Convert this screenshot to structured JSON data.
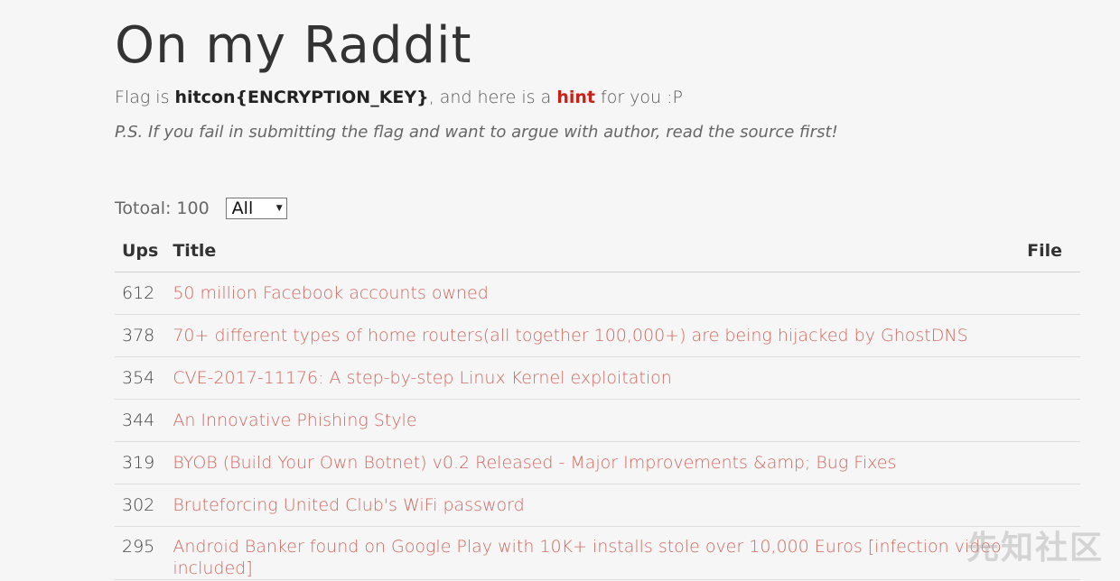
{
  "header": {
    "title": "On my Raddit",
    "flag_prefix": "Flag is ",
    "flag_value": "hitcon{ENCRYPTION_KEY}",
    "flag_middle": ", and here is a ",
    "hint_label": "hint",
    "flag_suffix": " for you :P",
    "ps_note": "P.S. If you fail in submitting the flag and want to argue with author, read the source first!"
  },
  "summary": {
    "total_label": "Totoal:",
    "total_value": "100",
    "filter_selected": "All"
  },
  "table": {
    "columns": [
      "Ups",
      "Title",
      "File"
    ],
    "rows": [
      {
        "ups": "612",
        "title": "50 million Facebook accounts owned"
      },
      {
        "ups": "378",
        "title": "70+ different types of home routers(all together 100,000+) are being hijacked by GhostDNS"
      },
      {
        "ups": "354",
        "title": "CVE-2017-11176: A step-by-step Linux Kernel exploitation"
      },
      {
        "ups": "344",
        "title": "An Innovative Phishing Style"
      },
      {
        "ups": "319",
        "title": "BYOB (Build Your Own Botnet) v0.2 Released - Major Improvements &amp; Bug Fixes"
      },
      {
        "ups": "302",
        "title": "Bruteforcing United Club's WiFi password"
      },
      {
        "ups": "295",
        "title": "Android Banker found on Google Play with 10K+ installs stole over 10,000 Euros [infection video included]"
      }
    ]
  },
  "watermark": "先知社区",
  "colors": {
    "background": "#f6f6f6",
    "hint": "#cc1f16",
    "link": "#d2685f"
  }
}
